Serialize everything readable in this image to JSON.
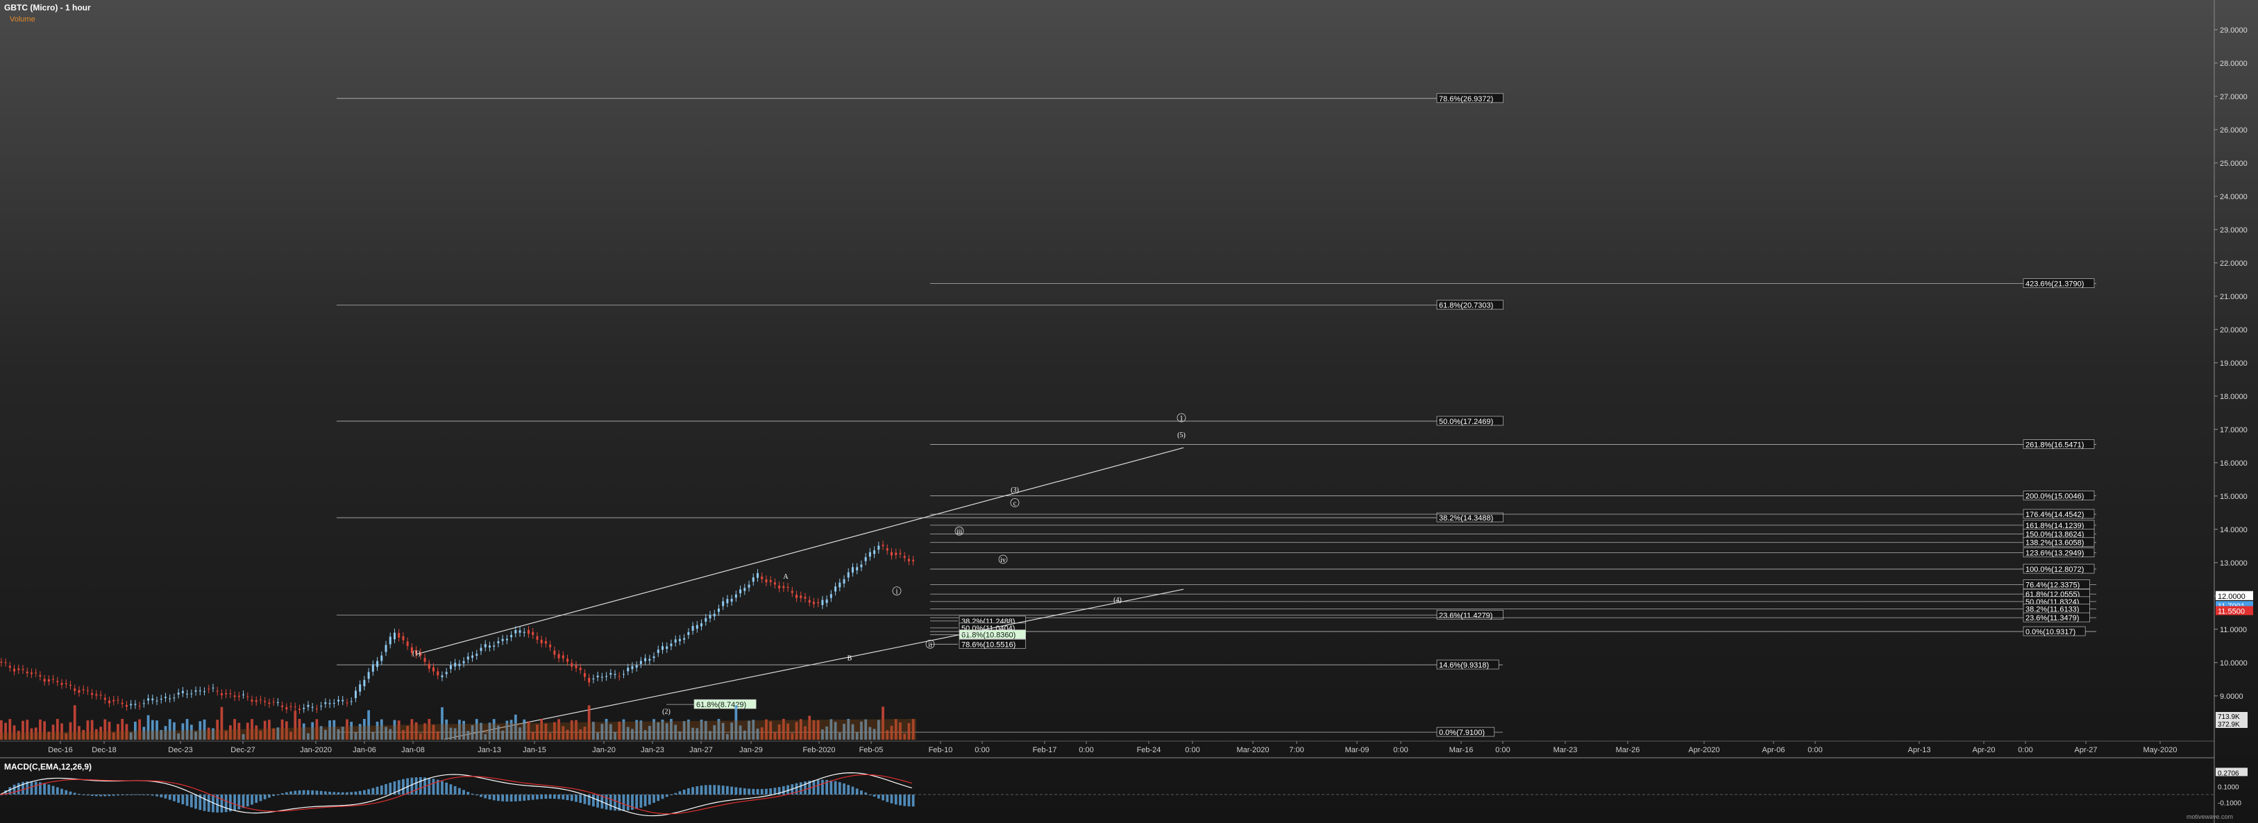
{
  "header": {
    "title": "GBTC (Micro) - 1 hour",
    "subtitle": "Volume"
  },
  "macd": {
    "label": "MACD(C,EMA,12,26,9)"
  },
  "credit": "motivewave.com",
  "chart_data": {
    "type": "line",
    "title": "GBTC (Micro) - 1 hour",
    "ylim": [
      7.6,
      29.6
    ],
    "y_ticks": [
      "29.0000",
      "28.0000",
      "27.0000",
      "26.0000",
      "25.0000",
      "24.0000",
      "23.0000",
      "22.0000",
      "21.0000",
      "20.0000",
      "19.0000",
      "18.0000",
      "17.0000",
      "16.0000",
      "15.0000",
      "14.0000",
      "13.0000",
      "12.0000",
      "11.0000",
      "10.0000",
      "9.0000"
    ],
    "x_ticks": [
      "Dec-16",
      "Dec-18",
      "Dec-23",
      "Dec-27",
      "Jan-2020",
      "Jan-06",
      "Jan-08",
      "Jan-13",
      "Jan-15",
      "Jan-20",
      "Jan-23",
      "Jan-27",
      "Jan-29",
      "Feb-2020",
      "Feb-05",
      "Feb-10",
      "0:00",
      "Feb-17",
      "0:00",
      "Feb-24",
      "0:00",
      "Mar-2020",
      "7:00",
      "Mar-09",
      "0:00",
      "Mar-16",
      "0:00",
      "Mar-23",
      "Mar-26",
      "Apr-2020",
      "Apr-06",
      "0:00",
      "Apr-13",
      "Apr-20",
      "0:00",
      "Apr-27",
      "May-2020"
    ],
    "price_labels": [
      {
        "text": "12.0000",
        "color": "#ffffff"
      },
      {
        "text": "11.7001",
        "color": "#4aa0e8"
      },
      {
        "text": "11.5500",
        "color": "#e03030"
      }
    ],
    "volume_axis": [
      "713.9K",
      "372.9K"
    ],
    "macd_axis": [
      "0.2706",
      "0.1000",
      "-0.1000"
    ],
    "fib_levels": [
      {
        "group": "A",
        "label": "78.6%(26.9372)",
        "value": 26.9372
      },
      {
        "group": "A",
        "label": "61.8%(20.7303)",
        "value": 20.7303
      },
      {
        "group": "A",
        "label": "50.0%(17.2469)",
        "value": 17.2469
      },
      {
        "group": "A",
        "label": "38.2%(14.3488)",
        "value": 14.3488
      },
      {
        "group": "A",
        "label": "23.6%(11.4279)",
        "value": 11.4279
      },
      {
        "group": "A",
        "label": "14.6%(9.9318)",
        "value": 9.9318
      },
      {
        "group": "A",
        "label": "0.0%(7.9100)",
        "value": 7.91
      },
      {
        "group": "B",
        "label": "423.6%(21.3790)",
        "value": 21.379
      },
      {
        "group": "B",
        "label": "261.8%(16.5471)",
        "value": 16.5471
      },
      {
        "group": "B",
        "label": "200.0%(15.0046)",
        "value": 15.0046
      },
      {
        "group": "B",
        "label": "176.4%(14.4542)",
        "value": 14.4542
      },
      {
        "group": "B",
        "label": "161.8%(14.1239)",
        "value": 14.1239
      },
      {
        "group": "B",
        "label": "150.0%(13.8624)",
        "value": 13.8624
      },
      {
        "group": "B",
        "label": "138.2%(13.6058)",
        "value": 13.6058
      },
      {
        "group": "B",
        "label": "123.6%(13.2949)",
        "value": 13.2949
      },
      {
        "group": "B",
        "label": "100.0%(12.8072)",
        "value": 12.8072
      },
      {
        "group": "B",
        "label": "76.4%(12.3375)",
        "value": 12.3375
      },
      {
        "group": "B",
        "label": "61.8%(12.0555)",
        "value": 12.0555
      },
      {
        "group": "B",
        "label": "50.0%(11.8324)",
        "value": 11.8324
      },
      {
        "group": "B",
        "label": "38.2%(11.6133)",
        "value": 11.6133
      },
      {
        "group": "B",
        "label": "23.6%(11.3479)",
        "value": 11.3479
      },
      {
        "group": "B",
        "label": "0.0%(10.9317)",
        "value": 10.9317
      },
      {
        "group": "C",
        "label": "38.2%(11.2488)",
        "value": 11.2488
      },
      {
        "group": "C",
        "label": "50.0%(11.0404)",
        "value": 11.0404
      },
      {
        "group": "C",
        "label": "61.8%(10.8360)",
        "value": 10.836
      },
      {
        "group": "C",
        "label": "78.6%(10.5516)",
        "value": 10.5516
      },
      {
        "group": "D",
        "label": "61.8%(8.7429)",
        "value": 8.7429
      }
    ],
    "wave_labels": [
      "(1)",
      "(2)",
      "A",
      "B",
      "i",
      "ii",
      "iii",
      "iv",
      "(3)",
      "c",
      "(4)",
      "1",
      "(5)"
    ],
    "candles": {
      "start": 10.0,
      "legs": [
        [
          -1.3,
          30
        ],
        [
          0.5,
          18
        ],
        [
          -0.6,
          22
        ],
        [
          0.3,
          12
        ],
        [
          2.0,
          10
        ],
        [
          -1.3,
          10
        ],
        [
          0.8,
          10
        ],
        [
          0.6,
          10
        ],
        [
          -1.5,
          15
        ],
        [
          0.2,
          8
        ],
        [
          1.2,
          15
        ],
        [
          1.7,
          16
        ],
        [
          -0.9,
          14
        ],
        [
          1.1,
          8
        ],
        [
          0.7,
          6
        ],
        [
          -0.5,
          8
        ]
      ]
    }
  }
}
